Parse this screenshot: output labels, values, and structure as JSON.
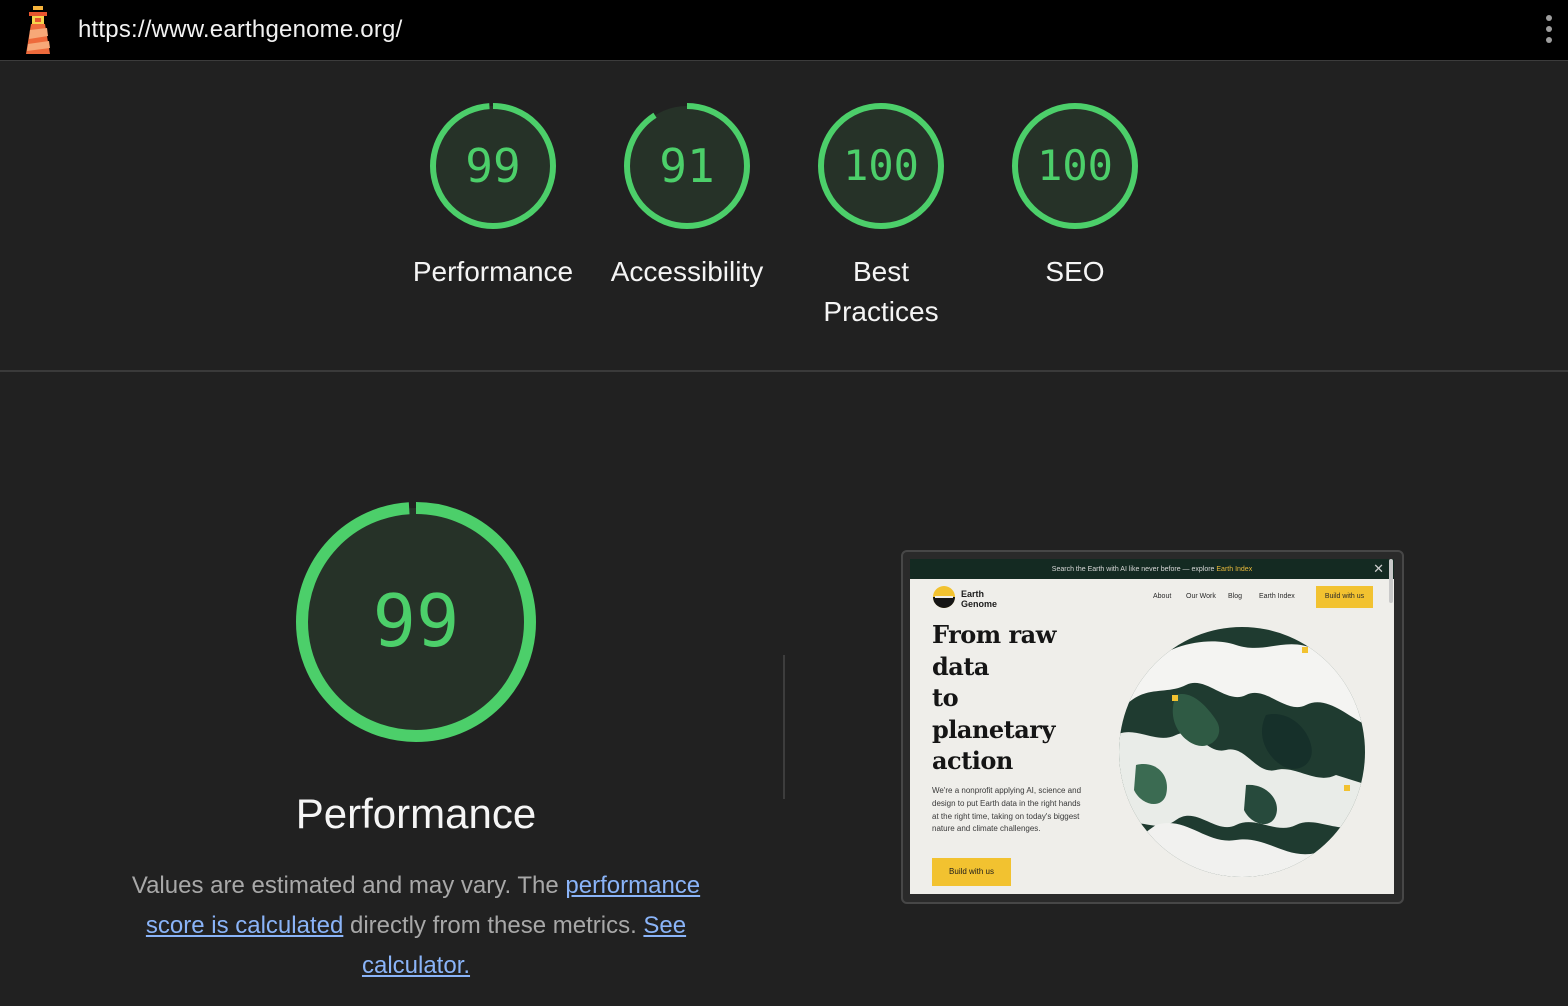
{
  "browser": {
    "url": "https://www.earthgenome.org/",
    "logo_icon": "lighthouse-icon",
    "menu_icon": "kebab-menu-icon"
  },
  "colors": {
    "pass_green": "#4ccf6a",
    "gauge_fill": "#263228",
    "background": "#212121",
    "link": "#8ab4f8"
  },
  "summary": {
    "gauges": [
      {
        "score": "99",
        "value": 0.99,
        "label": "Performance"
      },
      {
        "score": "91",
        "value": 0.91,
        "label": "Accessibility"
      },
      {
        "score": "100",
        "value": 1.0,
        "label": "Best Practices"
      },
      {
        "score": "100",
        "value": 1.0,
        "label": "SEO"
      }
    ]
  },
  "performance": {
    "score": "99",
    "value": 0.99,
    "title": "Performance",
    "desc_prefix": "Values are estimated and may vary. The ",
    "link_calc": "performance score is calculated",
    "desc_middle": " directly from these metrics. ",
    "link_see": "See calculator."
  },
  "thumbnail": {
    "banner_text": "Search the Earth with AI like never before — explore ",
    "banner_link": "Earth Index",
    "brand_line1": "Earth",
    "brand_line2": "Genome",
    "nav": [
      "About",
      "Our Work",
      "Blog",
      "Earth Index"
    ],
    "cta": "Build with us",
    "hero": [
      "From raw",
      "data",
      "to",
      "planetary",
      "action"
    ],
    "subtext": "We're a nonprofit applying AI, science and design to put Earth data in the right hands at the right time, taking on today's biggest nature and climate challenges.",
    "button": "Build with us"
  }
}
